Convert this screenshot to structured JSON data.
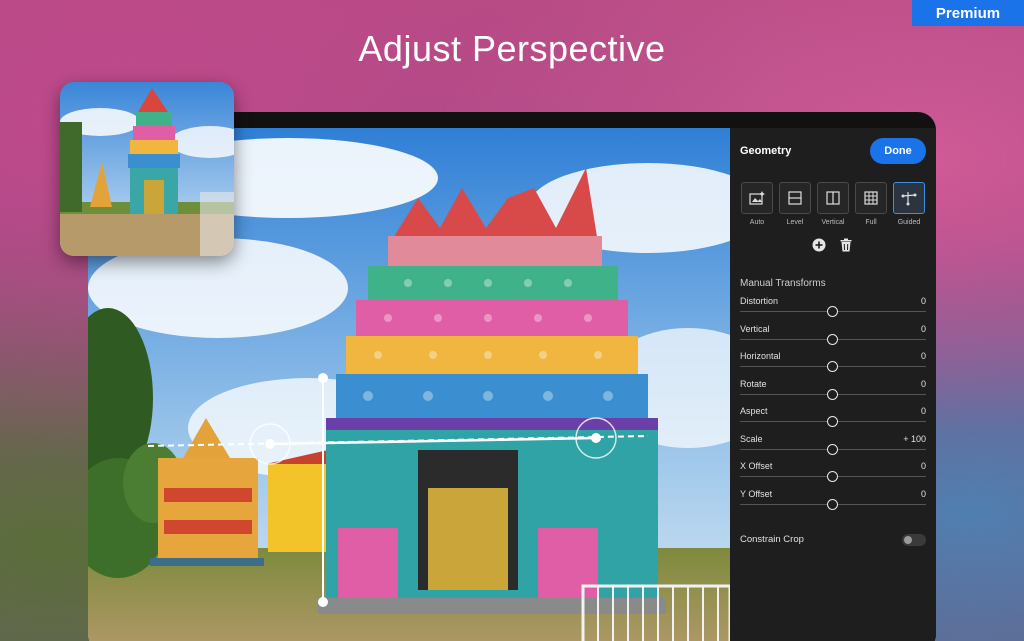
{
  "badge": {
    "label": "Premium"
  },
  "hero": {
    "title": "Adjust Perspective"
  },
  "panel": {
    "title": "Geometry",
    "done_label": "Done",
    "modes": [
      {
        "label": "Auto",
        "icon": "auto-upright-icon"
      },
      {
        "label": "Level",
        "icon": "level-icon"
      },
      {
        "label": "Vertical",
        "icon": "vertical-icon"
      },
      {
        "label": "Full",
        "icon": "full-grid-icon"
      },
      {
        "label": "Guided",
        "icon": "guided-icon",
        "active": true
      }
    ],
    "manual_title": "Manual Transforms",
    "sliders": [
      {
        "label": "Distortion",
        "value": "0"
      },
      {
        "label": "Vertical",
        "value": "0"
      },
      {
        "label": "Horizontal",
        "value": "0"
      },
      {
        "label": "Rotate",
        "value": "0"
      },
      {
        "label": "Aspect",
        "value": "0"
      },
      {
        "label": "Scale",
        "value": "+ 100"
      },
      {
        "label": "X Offset",
        "value": "0"
      },
      {
        "label": "Y Offset",
        "value": "0"
      }
    ],
    "constrain_label": "Constrain Crop",
    "constrain_on": false
  },
  "colors": {
    "accent": "#1a73e8",
    "panel_bg": "#1e1e1e",
    "active_border": "#3d8fe0"
  }
}
